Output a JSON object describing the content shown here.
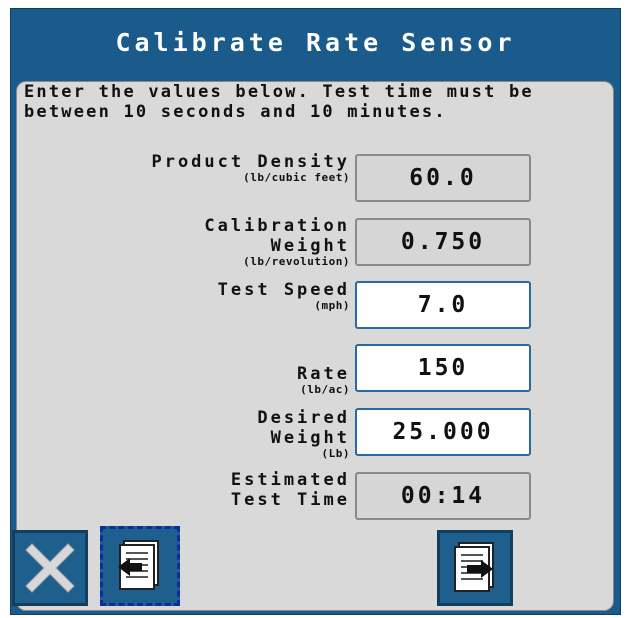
{
  "title": "Calibrate Rate Sensor",
  "instructions": "Enter the values below. Test time must be between 10 seconds and 10 minutes.",
  "fields": {
    "product_density": {
      "label": "Product Density",
      "unit": "(lb/cubic feet)",
      "value": "60.0"
    },
    "calibration_weight": {
      "label": "Calibration Weight",
      "unit": "(lb/revolution)",
      "value": "0.750"
    },
    "test_speed": {
      "label": "Test Speed",
      "unit": "(mph)",
      "value": "7.0"
    },
    "rate": {
      "label": "Rate",
      "unit": "(lb/ac)",
      "value": "150"
    },
    "desired_weight": {
      "label": "Desired Weight",
      "unit": "(Lb)",
      "value": "25.000"
    },
    "estimated_test_time": {
      "label": "Estimated Test Time",
      "value": "00:14"
    }
  },
  "buttons": {
    "cancel": "cancel-icon",
    "back": "page-back-icon",
    "next": "page-next-icon"
  },
  "colors": {
    "frame": "#1a5b8c",
    "panel": "#d9d9d9",
    "editable_field": "#ffffff",
    "readonly_field": "#d6d6d6"
  }
}
